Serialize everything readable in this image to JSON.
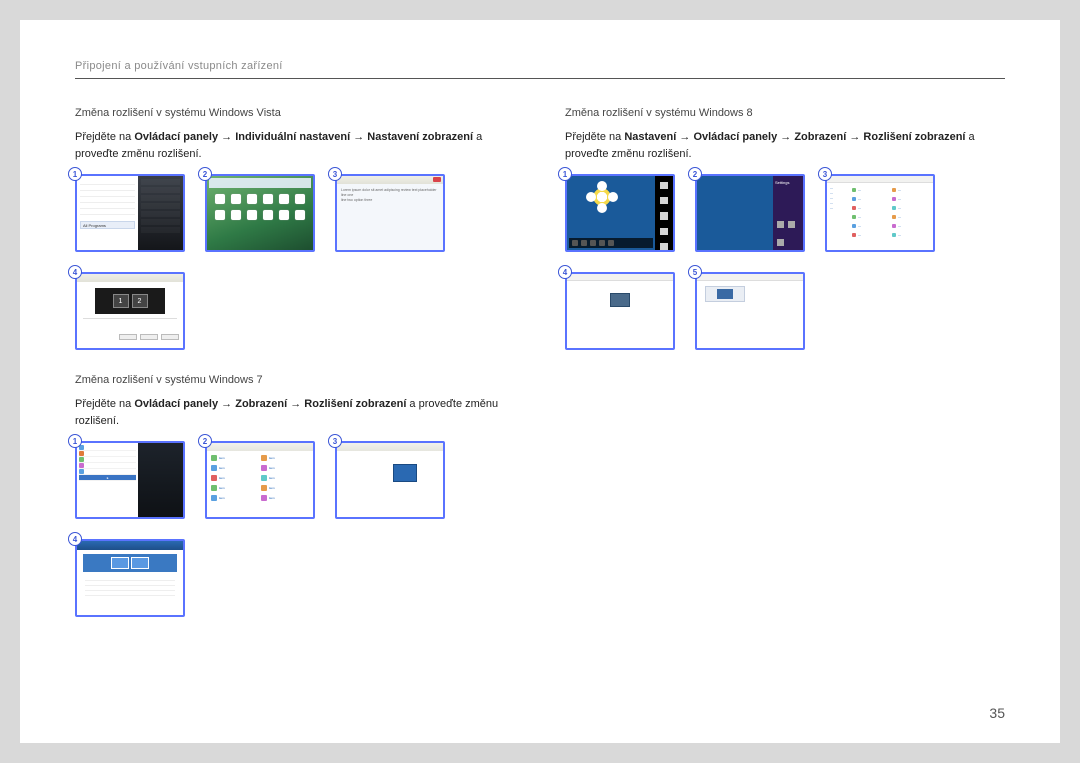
{
  "header": {
    "title": "Připojení a používání vstupních zařízení"
  },
  "page_number": "35",
  "arrow": "→",
  "vista": {
    "heading": "Změna rozlišení v systému Windows Vista",
    "p_prefix": "Přejděte na ",
    "b1": "Ovládací panely",
    "b2": "Individuální nastavení",
    "b3": "Nastavení zobrazení",
    "p_mid": " a proveďte změnu rozlišení.",
    "badges": [
      "1",
      "2",
      "3",
      "4"
    ]
  },
  "win7": {
    "heading": "Změna rozlišení v systému Windows 7",
    "p_prefix": "Přejděte na ",
    "b1": "Ovládací panely",
    "b2": "Zobrazení",
    "b3": "Rozlišení zobrazení",
    "p_mid": " a proveďte změnu rozlišení.",
    "badges": [
      "1",
      "2",
      "3",
      "4"
    ]
  },
  "win8": {
    "heading": "Změna rozlišení v systému Windows 8",
    "p_prefix": "Přejděte na ",
    "b1": "Nastavení",
    "b2": "Ovládací panely",
    "b3": "Zobrazení",
    "b4": "Rozlišení zobrazení",
    "p_mid": " a proveďte změnu rozlišení.",
    "badges": [
      "1",
      "2",
      "3",
      "4",
      "5"
    ]
  },
  "stub": {
    "all_programs": "All Programs",
    "mon1": "1",
    "mon2": "2"
  }
}
